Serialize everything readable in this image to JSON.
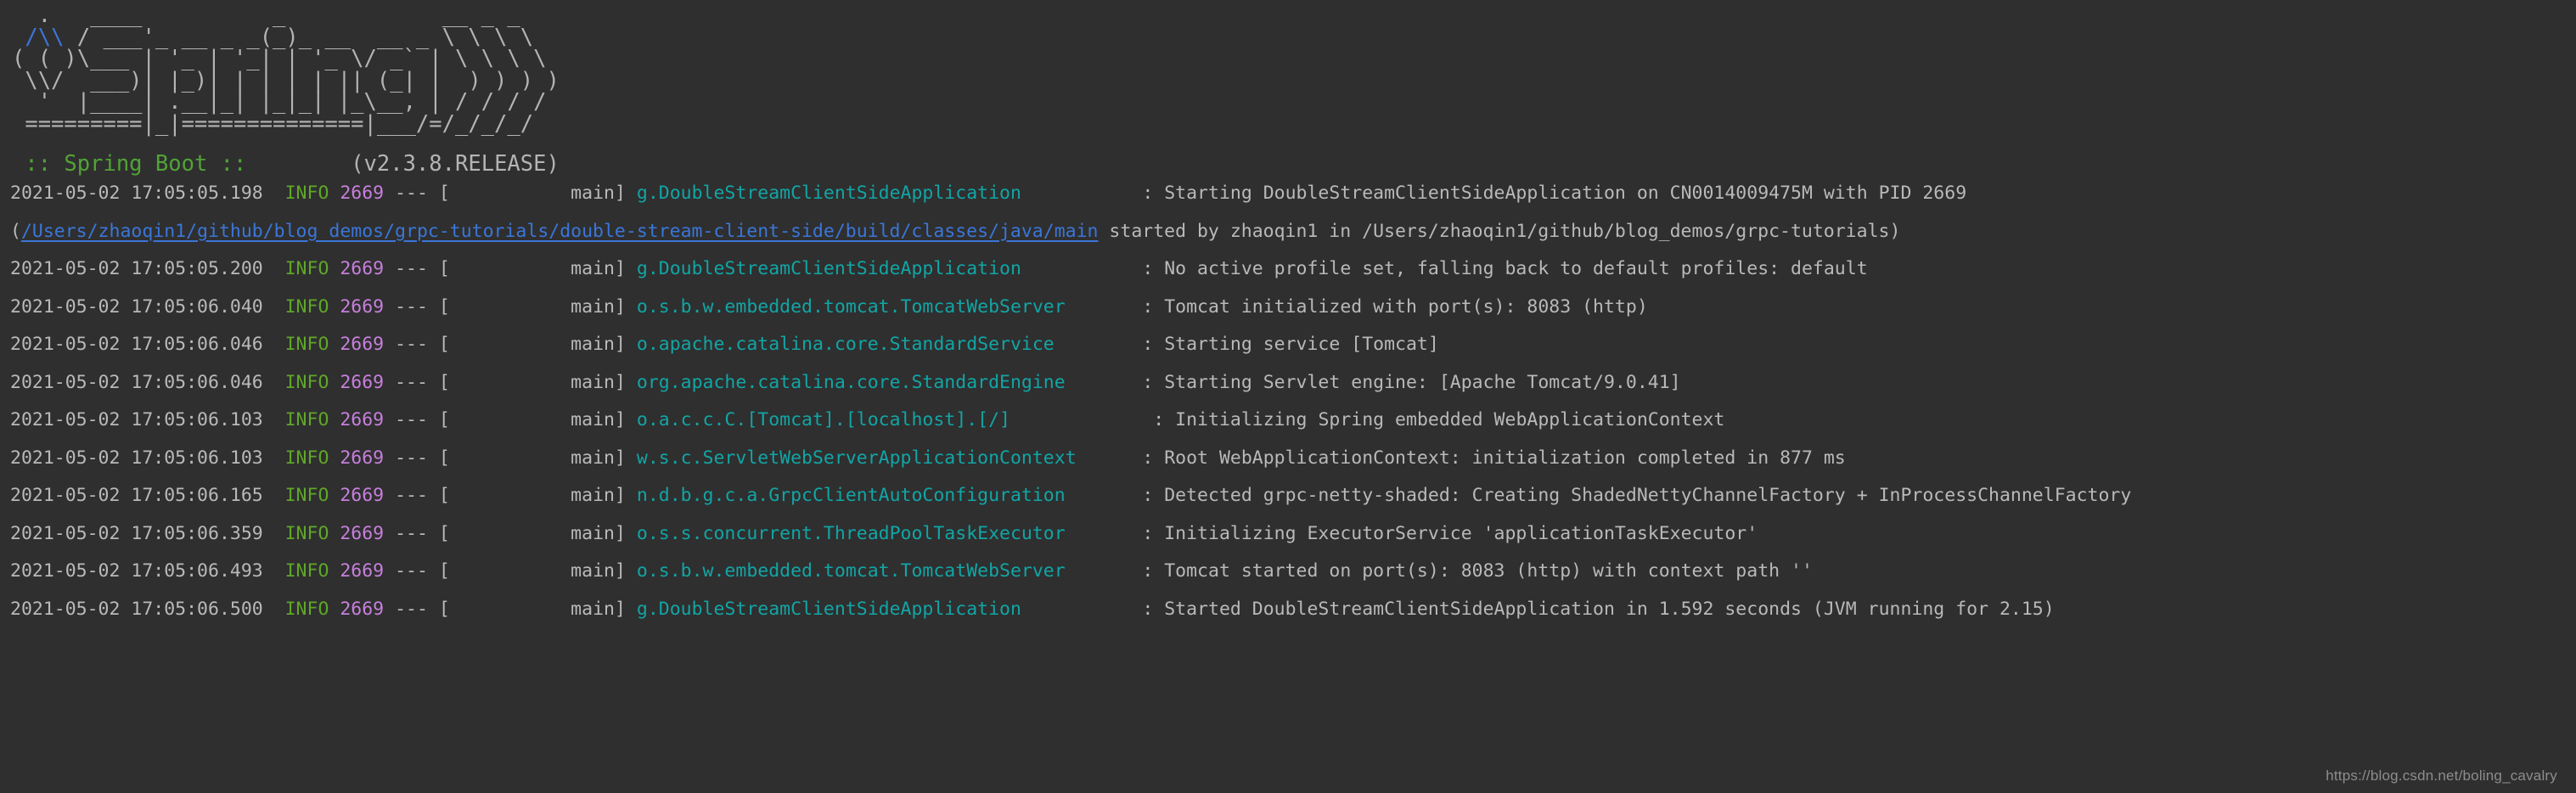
{
  "console": {
    "background_color": "#2f2f2f",
    "foreground_color": "#b9b9b9"
  },
  "banner": {
    "ascii_lines": [
      "  .   ____          _            __ _ _",
      " /\\\\ / ___'_ __ _ _(_)_ __  __ _ \\ \\ \\ \\",
      "( ( )\\___ | '_ | '_| | '_ \\/ _` | \\ \\ \\ \\",
      " \\\\/  ___)| |_)| | | | | || (_| |  ) ) ) )",
      "  '  |____| .__|_| |_|_| |_\\__, | / / / /",
      " =========|_|==============|___/=/_/_/_/"
    ],
    "leaf_glyph": "/\\\\",
    "leaf_color": "#3b76d8",
    "spring_boot_label": ":: Spring Boot ::",
    "spring_boot_color": "#51a336",
    "version": "(v2.3.8.RELEASE)",
    "version_gap": "        "
  },
  "log": {
    "level_color": "#5fa728",
    "pid_color": "#c77fdd",
    "logger_color": "#12a5a5",
    "link_color": "#3b76d8",
    "separator": " --- [",
    "thread_close": "]",
    "msg_prefix": " : ",
    "lines": [
      {
        "timestamp": "2021-05-02 17:05:05.198",
        "level": "INFO",
        "pid": "2669",
        "thread": "           main",
        "logger": "g.DoubleStreamClientSideApplication",
        "logger_pad": "          ",
        "message": "Starting DoubleStreamClientSideApplication on CN0014009475M with PID 2669"
      },
      {
        "continuation": true,
        "prefix": "(",
        "link": "/Users/zhaoqin1/github/blog_demos/grpc-tutorials/double-stream-client-side/build/classes/java/main",
        "suffix": " started by zhaoqin1 in /Users/zhaoqin1/github/blog_demos/grpc-tutorials)"
      },
      {
        "timestamp": "2021-05-02 17:05:05.200",
        "level": "INFO",
        "pid": "2669",
        "thread": "           main",
        "logger": "g.DoubleStreamClientSideApplication",
        "logger_pad": "          ",
        "message": "No active profile set, falling back to default profiles: default"
      },
      {
        "timestamp": "2021-05-02 17:05:06.040",
        "level": "INFO",
        "pid": "2669",
        "thread": "           main",
        "logger": "o.s.b.w.embedded.tomcat.TomcatWebServer",
        "logger_pad": "      ",
        "message": "Tomcat initialized with port(s): 8083 (http)"
      },
      {
        "timestamp": "2021-05-02 17:05:06.046",
        "level": "INFO",
        "pid": "2669",
        "thread": "           main",
        "logger": "o.apache.catalina.core.StandardService",
        "logger_pad": "       ",
        "message": "Starting service [Tomcat]"
      },
      {
        "timestamp": "2021-05-02 17:05:06.046",
        "level": "INFO",
        "pid": "2669",
        "thread": "           main",
        "logger": "org.apache.catalina.core.StandardEngine",
        "logger_pad": "      ",
        "message": "Starting Servlet engine: [Apache Tomcat/9.0.41]"
      },
      {
        "timestamp": "2021-05-02 17:05:06.103",
        "level": "INFO",
        "pid": "2669",
        "thread": "           main",
        "logger": "o.a.c.c.C.[Tomcat].[localhost].[/]",
        "logger_pad": "            ",
        "message": "Initializing Spring embedded WebApplicationContext"
      },
      {
        "timestamp": "2021-05-02 17:05:06.103",
        "level": "INFO",
        "pid": "2669",
        "thread": "           main",
        "logger": "w.s.c.ServletWebServerApplicationContext",
        "logger_pad": "     ",
        "message": "Root WebApplicationContext: initialization completed in 877 ms"
      },
      {
        "timestamp": "2021-05-02 17:05:06.165",
        "level": "INFO",
        "pid": "2669",
        "thread": "           main",
        "logger": "n.d.b.g.c.a.GrpcClientAutoConfiguration",
        "logger_pad": "      ",
        "message": "Detected grpc-netty-shaded: Creating ShadedNettyChannelFactory + InProcessChannelFactory"
      },
      {
        "timestamp": "2021-05-02 17:05:06.359",
        "level": "INFO",
        "pid": "2669",
        "thread": "           main",
        "logger": "o.s.s.concurrent.ThreadPoolTaskExecutor",
        "logger_pad": "      ",
        "message": "Initializing ExecutorService 'applicationTaskExecutor'"
      },
      {
        "timestamp": "2021-05-02 17:05:06.493",
        "level": "INFO",
        "pid": "2669",
        "thread": "           main",
        "logger": "o.s.b.w.embedded.tomcat.TomcatWebServer",
        "logger_pad": "      ",
        "message": "Tomcat started on port(s): 8083 (http) with context path ''"
      },
      {
        "timestamp": "2021-05-02 17:05:06.500",
        "level": "INFO",
        "pid": "2669",
        "thread": "           main",
        "logger": "g.DoubleStreamClientSideApplication",
        "logger_pad": "          ",
        "message": "Started DoubleStreamClientSideApplication in 1.592 seconds (JVM running for 2.15)"
      }
    ]
  },
  "watermark": {
    "text": "https://blog.csdn.net/boling_cavalry"
  }
}
